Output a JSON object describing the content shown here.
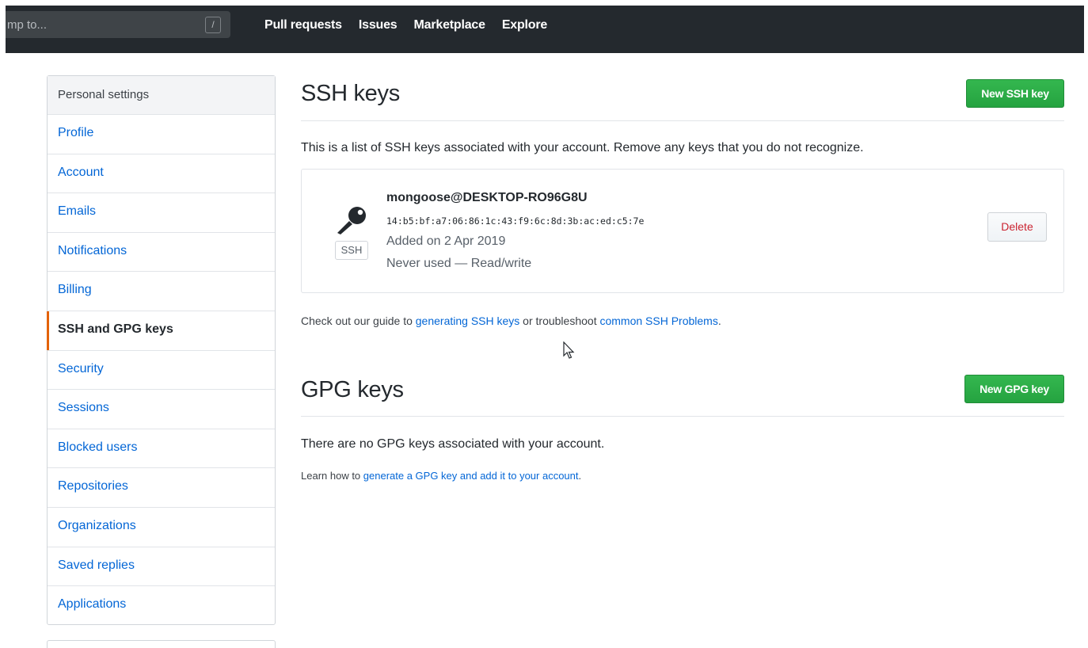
{
  "topbar": {
    "search_placeholder": "mp to...",
    "slash_key": "/",
    "nav": [
      "Pull requests",
      "Issues",
      "Marketplace",
      "Explore"
    ]
  },
  "sidebar": {
    "header": "Personal settings",
    "items": [
      {
        "label": "Profile"
      },
      {
        "label": "Account"
      },
      {
        "label": "Emails"
      },
      {
        "label": "Notifications"
      },
      {
        "label": "Billing"
      },
      {
        "label": "SSH and GPG keys",
        "active": true
      },
      {
        "label": "Security"
      },
      {
        "label": "Sessions"
      },
      {
        "label": "Blocked users"
      },
      {
        "label": "Repositories"
      },
      {
        "label": "Organizations"
      },
      {
        "label": "Saved replies"
      },
      {
        "label": "Applications"
      }
    ]
  },
  "ssh": {
    "title": "SSH keys",
    "new_button": "New SSH key",
    "description": "This is a list of SSH keys associated with your account. Remove any keys that you do not recognize.",
    "key": {
      "badge": "SSH",
      "title": "mongoose@DESKTOP-RO96G8U",
      "fingerprint": "14:b5:bf:a7:06:86:1c:43:f9:6c:8d:3b:ac:ed:c5:7e",
      "added": "Added on 2 Apr 2019",
      "usage": "Never used — Read/write",
      "delete_label": "Delete"
    },
    "guide": {
      "prefix": "Check out our guide to ",
      "link1": "generating SSH keys",
      "middle": " or troubleshoot ",
      "link2": "common SSH Problems",
      "suffix": "."
    }
  },
  "gpg": {
    "title": "GPG keys",
    "new_button": "New GPG key",
    "empty_text": "There are no GPG keys associated with your account.",
    "learn": {
      "prefix": "Learn how to ",
      "link": "generate a GPG key and add it to your account",
      "suffix": "."
    }
  },
  "colors": {
    "topbar_bg": "#24292e",
    "link": "#0366d6",
    "primary_green": "#28a745",
    "danger": "#cb2431",
    "active_accent": "#e36209"
  }
}
